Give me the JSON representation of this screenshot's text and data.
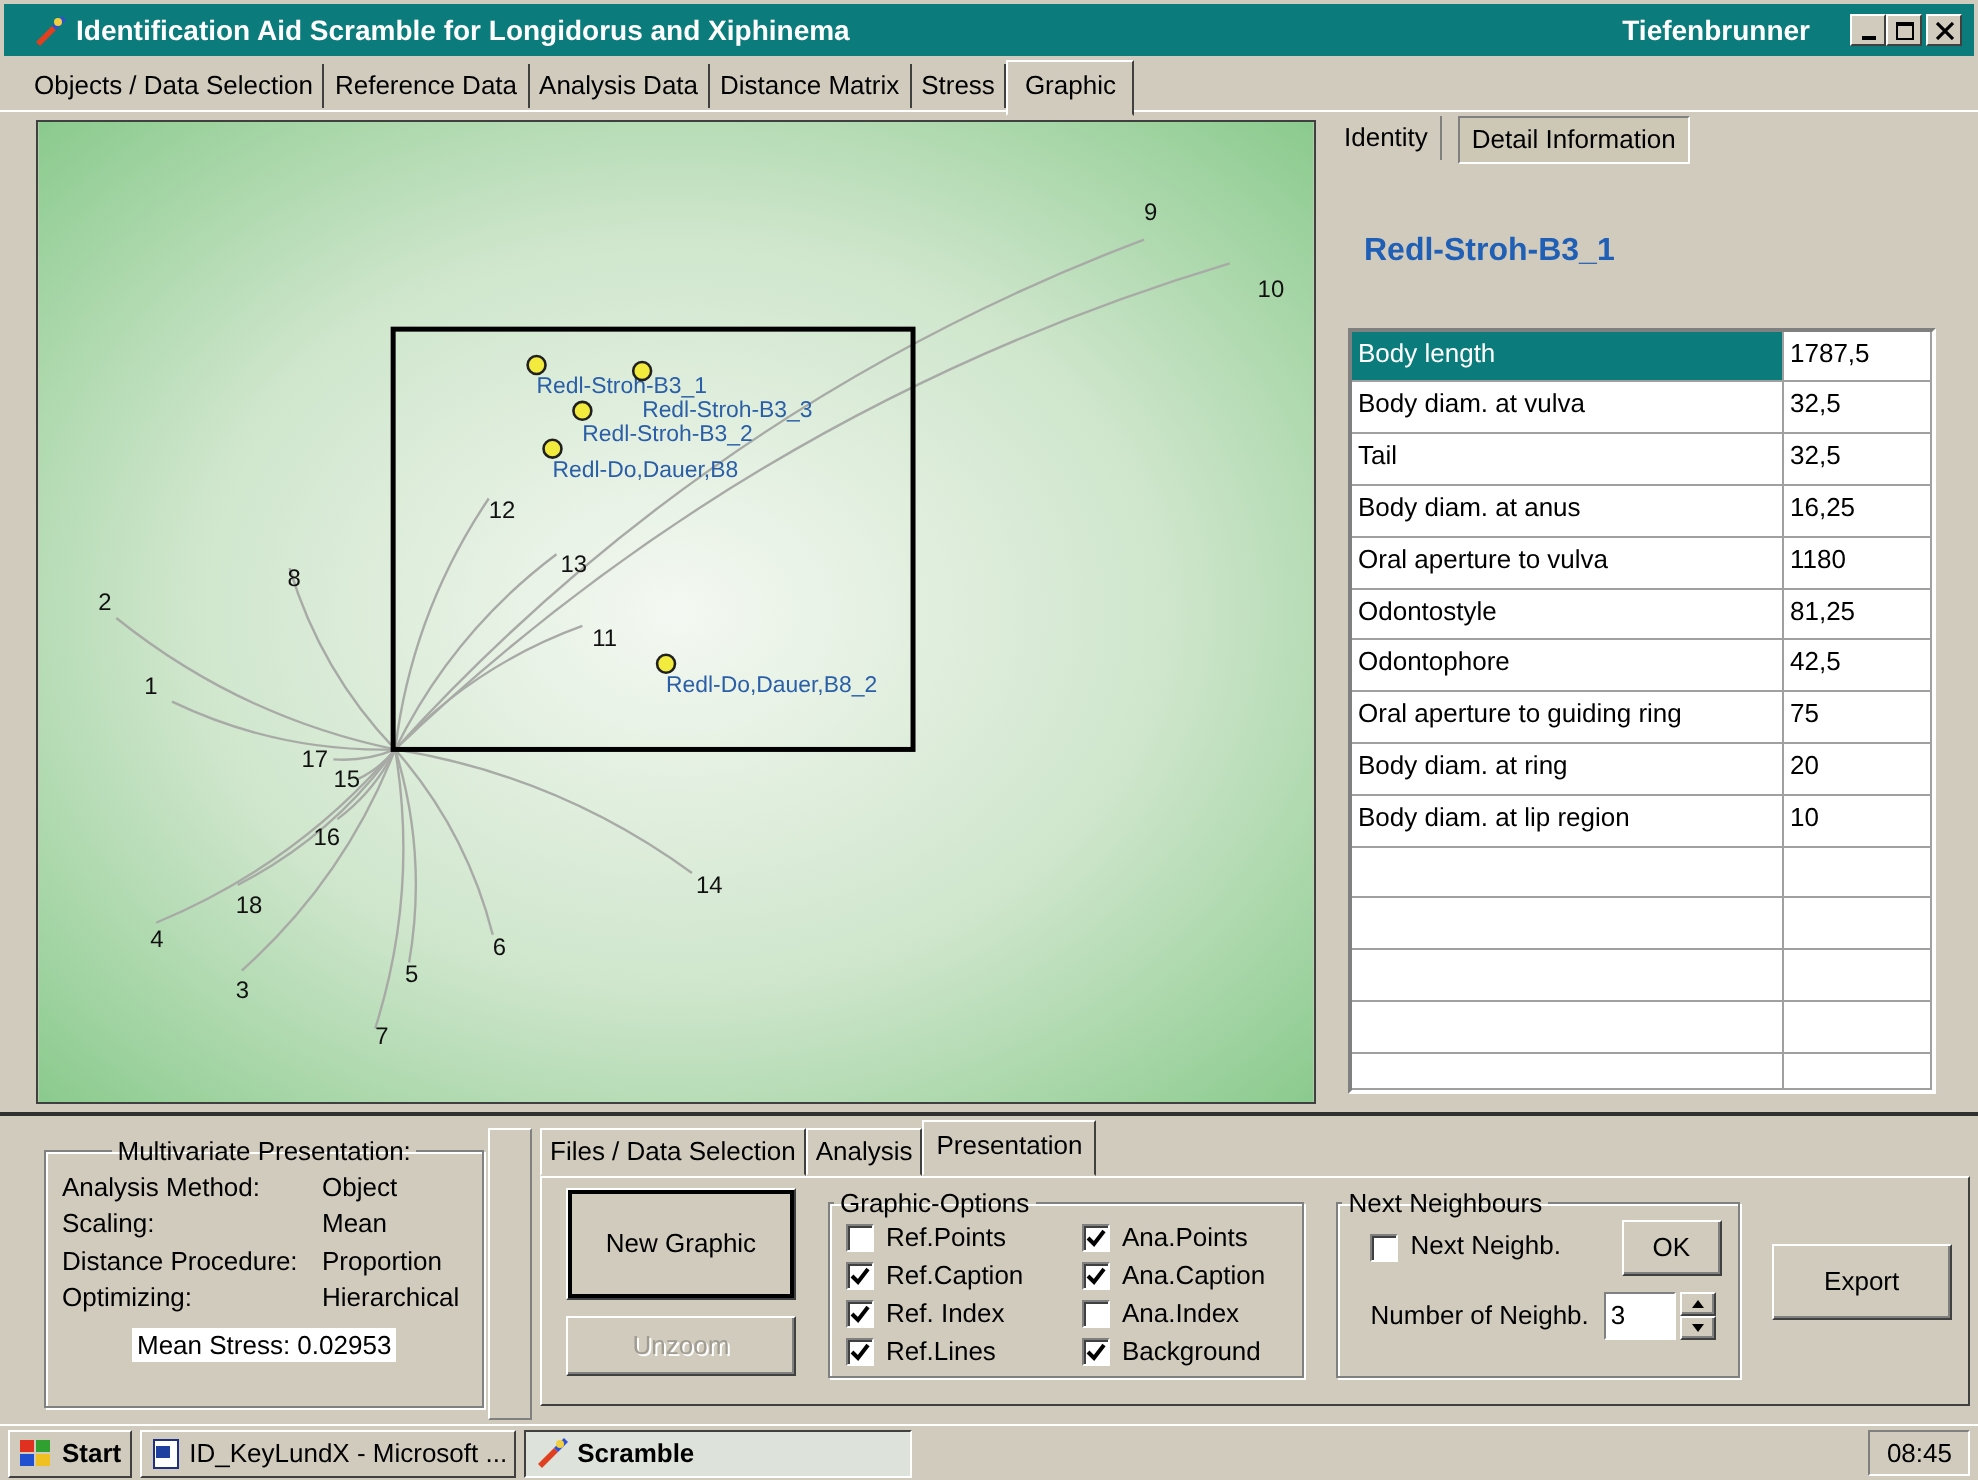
{
  "window": {
    "title": "Identification Aid Scramble for Longidorus and Xiphinema",
    "user": "Tiefenbrunner"
  },
  "tabs": [
    {
      "label": "Objects / Data Selection",
      "selected": false
    },
    {
      "label": "Reference Data",
      "selected": false
    },
    {
      "label": "Analysis Data",
      "selected": false
    },
    {
      "label": "Distance Matrix",
      "selected": false
    },
    {
      "label": "Stress",
      "selected": false
    },
    {
      "label": "Graphic",
      "selected": true
    }
  ],
  "graphic": {
    "reference_points": [
      "1",
      "2",
      "3",
      "4",
      "5",
      "6",
      "7",
      "8",
      "9",
      "10",
      "11",
      "12",
      "13",
      "14",
      "15",
      "16",
      "17",
      "18"
    ],
    "analysis_points": [
      "Redl-Stroh-B3_1",
      "Redl-Stroh-B3_3",
      "Redl-Stroh-B3_2",
      "Redl-Do,Dauer,B8",
      "Redl-Do,Dauer,B8_2"
    ]
  },
  "detail": {
    "tabs": [
      {
        "label": "Identity",
        "selected": false
      },
      {
        "label": "Detail Information",
        "selected": true
      }
    ],
    "title": "Redl-Stroh-B3_1",
    "rows": [
      {
        "name": "Body length",
        "value": "1787,5",
        "selected": true
      },
      {
        "name": "Body diam. at vulva",
        "value": "32,5",
        "selected": false
      },
      {
        "name": "Tail",
        "value": "32,5",
        "selected": false
      },
      {
        "name": "Body diam. at anus",
        "value": "16,25",
        "selected": false
      },
      {
        "name": "Oral aperture to vulva",
        "value": "1180",
        "selected": false
      },
      {
        "name": "Odontostyle",
        "value": "81,25",
        "selected": false
      },
      {
        "name": "Odontophore",
        "value": "42,5",
        "selected": false
      },
      {
        "name": "Oral aperture to guiding ring",
        "value": "75",
        "selected": false
      },
      {
        "name": "Body diam. at ring",
        "value": "20",
        "selected": false
      },
      {
        "name": "Body diam. at lip region",
        "value": "10",
        "selected": false
      }
    ]
  },
  "multivariate": {
    "title": "Multivariate Presentation:",
    "fields": [
      {
        "label": "Analysis Method:",
        "value": "Object"
      },
      {
        "label": "Scaling:",
        "value": "Mean"
      },
      {
        "label": "Distance Procedure:",
        "value": "Proportion"
      },
      {
        "label": "Optimizing:",
        "value": "Hierarchical"
      }
    ],
    "mean_stress": "Mean Stress: 0.02953"
  },
  "bottom_tabs": [
    {
      "label": "Files / Data Selection",
      "selected": false
    },
    {
      "label": "Analysis",
      "selected": false
    },
    {
      "label": "Presentation",
      "selected": true
    }
  ],
  "new_graphic": {
    "label": "New Graphic",
    "disabled": false
  },
  "unzoom": {
    "label": "Unzoom",
    "disabled": true
  },
  "graphic_options": {
    "title": "Graphic-Options",
    "options": [
      {
        "label": "Ref.Points",
        "checked": false
      },
      {
        "label": "Ref.Caption",
        "checked": true
      },
      {
        "label": "Ref. Index",
        "checked": true
      },
      {
        "label": "Ref.Lines",
        "checked": true
      },
      {
        "label": "Ana.Points",
        "checked": true
      },
      {
        "label": "Ana.Caption",
        "checked": true
      },
      {
        "label": "Ana.Index",
        "checked": false
      },
      {
        "label": "Background",
        "checked": true
      }
    ]
  },
  "next_neighbours": {
    "title": "Next Neighbours",
    "checkbox": {
      "label": "Next Neighb.",
      "checked": false
    },
    "ok": "OK",
    "count_label": "Number of Neighb.",
    "count": "3"
  },
  "export": "Export",
  "taskbar": {
    "start": "Start",
    "tasks": [
      {
        "label": "ID_KeyLundX - Microsoft ...",
        "selected": false
      },
      {
        "label": "Scramble",
        "selected": true
      }
    ],
    "clock": "08:45"
  }
}
